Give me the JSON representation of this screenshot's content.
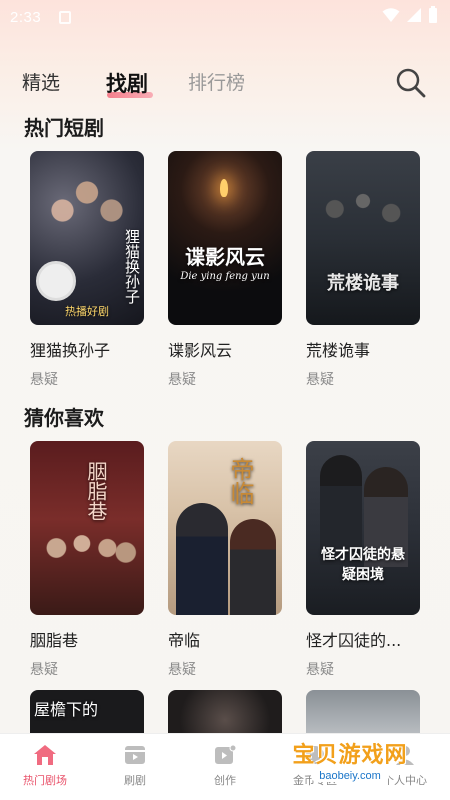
{
  "status_bar": {
    "time": "2:33"
  },
  "top_nav": {
    "tabs": [
      {
        "label": "精选"
      },
      {
        "label": "找剧"
      },
      {
        "label": "排行榜"
      }
    ],
    "active_tab": "找剧"
  },
  "sections": {
    "hot": {
      "title": "热门短剧"
    },
    "guess": {
      "title": "猜你喜欢"
    }
  },
  "hot_dramas": [
    {
      "title": "狸猫换孙子",
      "genre": "悬疑",
      "poster_text": "狸猫换孙子",
      "poster_banner": "热播好剧"
    },
    {
      "title": "谍影风云",
      "genre": "悬疑",
      "poster_text": "谍影风云",
      "poster_sub": "Die ying feng yun"
    },
    {
      "title": "荒楼诡事",
      "genre": "悬疑",
      "poster_text": "荒楼诡事"
    }
  ],
  "guess_dramas": [
    {
      "title": "胭脂巷",
      "genre": "悬疑",
      "poster_text": "胭脂巷"
    },
    {
      "title": "帝临",
      "genre": "悬疑",
      "poster_text": "帝临"
    },
    {
      "title": "怪才囚徒的...",
      "genre": "悬疑",
      "poster_text": "怪才囚徒的悬疑困境"
    }
  ],
  "partial_row": [
    {
      "poster_text": "屋檐下的"
    },
    {
      "poster_text": ""
    },
    {
      "poster_text": ""
    }
  ],
  "bottom_nav": [
    {
      "label": "热门剧场",
      "icon": "home-icon",
      "active": true
    },
    {
      "label": "刷剧",
      "icon": "film-icon",
      "active": false
    },
    {
      "label": "创作",
      "icon": "create-icon",
      "active": false
    },
    {
      "label": "金币专区",
      "icon": "coin-icon",
      "active": false
    },
    {
      "label": "个人中心",
      "icon": "profile-icon",
      "active": false
    }
  ],
  "watermark": {
    "main": "宝贝游戏网",
    "sub": "baobeiy.com"
  },
  "colors": {
    "accent": "#e9536b",
    "background": "#f7f5f2",
    "watermark_orange": "#f2a01b"
  }
}
